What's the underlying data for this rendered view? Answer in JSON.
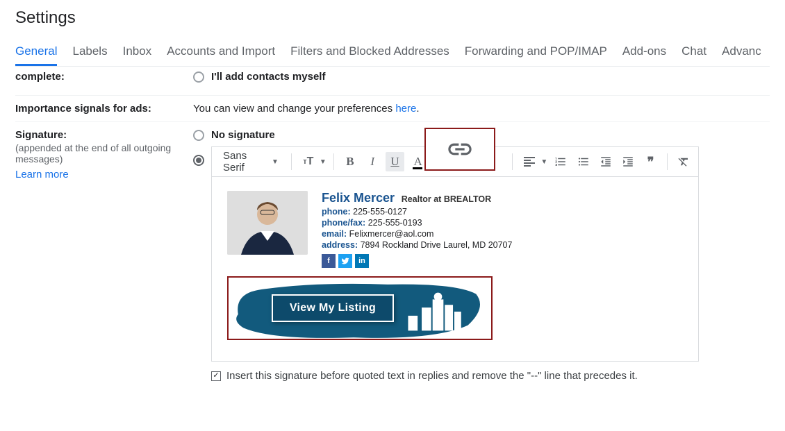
{
  "page_title": "Settings",
  "tabs": [
    {
      "label": "General",
      "active": true
    },
    {
      "label": "Labels"
    },
    {
      "label": "Inbox"
    },
    {
      "label": "Accounts and Import"
    },
    {
      "label": "Filters and Blocked Addresses"
    },
    {
      "label": "Forwarding and POP/IMAP"
    },
    {
      "label": "Add-ons"
    },
    {
      "label": "Chat"
    },
    {
      "label": "Advanc"
    }
  ],
  "auto_complete": {
    "label": "complete:",
    "option": "I'll add contacts myself"
  },
  "importance": {
    "label": "Importance signals for ads:",
    "text_pre": "You can view and change your preferences ",
    "link": "here",
    "text_post": "."
  },
  "signature_section": {
    "label": "Signature:",
    "sub": "(appended at the end of all outgoing messages)",
    "learn": "Learn more",
    "no_sig": "No signature"
  },
  "toolbar": {
    "font": "Sans Serif"
  },
  "signature": {
    "name": "Felix Mercer",
    "title": "Realtor at BREALTOR",
    "phone_label": "phone:",
    "phone": "225-555-0127",
    "fax_label": "phone/fax:",
    "fax": "225-555-0193",
    "email_label": "email:",
    "email": "Felixmercer@aol.com",
    "address_label": "address:",
    "address": "7894 Rockland Drive Laurel, MD 20707",
    "banner_btn": "View My Listing"
  },
  "insert_checkbox": {
    "label": "Insert this signature before quoted text in replies and remove the \"--\" line that precedes it.",
    "checked": true
  }
}
